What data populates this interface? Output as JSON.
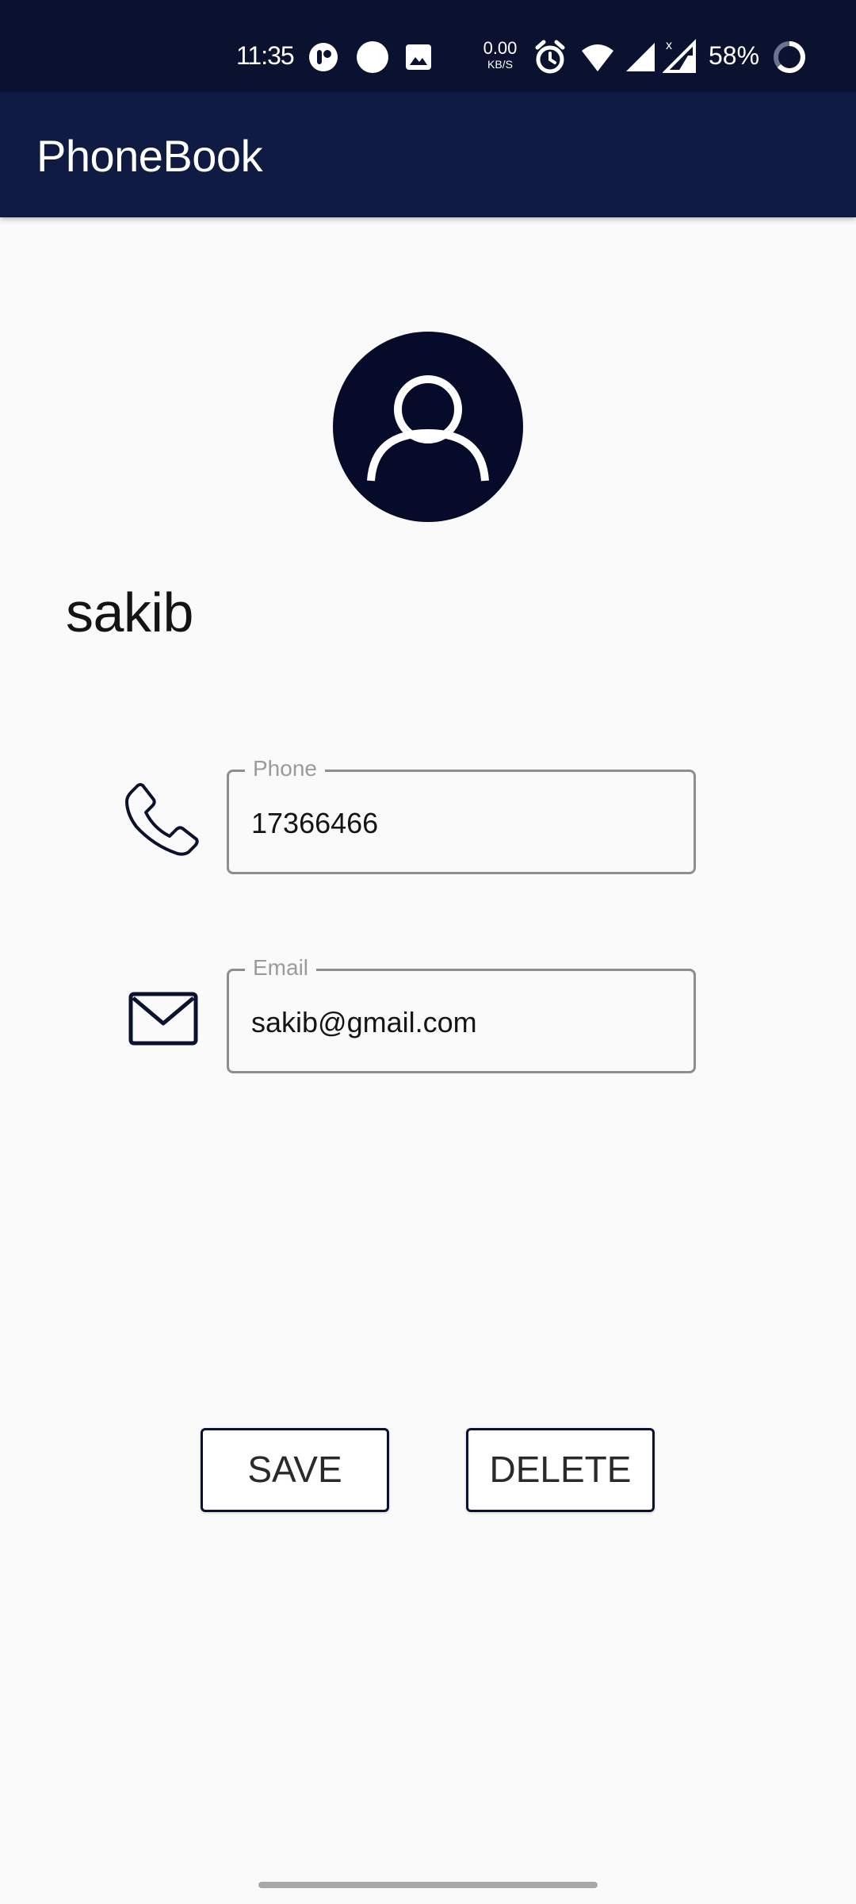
{
  "status_bar": {
    "time": "11:35",
    "net_speed_value": "0.00",
    "net_speed_unit": "KB/S",
    "battery": "58%",
    "icons": [
      "app-notification-icon",
      "circle-notification-icon",
      "image-icon",
      "alarm-icon",
      "wifi-icon",
      "signal-icon",
      "signal-no-data-icon",
      "battery-icon"
    ]
  },
  "app_bar": {
    "title": "PhoneBook"
  },
  "contact": {
    "name": "sakib",
    "avatar_icon": "person-icon"
  },
  "fields": {
    "phone": {
      "label": "Phone",
      "value": "17366466",
      "icon": "phone-icon"
    },
    "email": {
      "label": "Email",
      "value": "sakib@gmail.com",
      "icon": "mail-icon"
    }
  },
  "actions": {
    "save_label": "SAVE",
    "delete_label": "DELETE"
  },
  "colors": {
    "status_bar_bg": "#0b1230",
    "app_bar_bg": "#101b44",
    "avatar_bg": "#050b28",
    "background": "#fafafa"
  }
}
